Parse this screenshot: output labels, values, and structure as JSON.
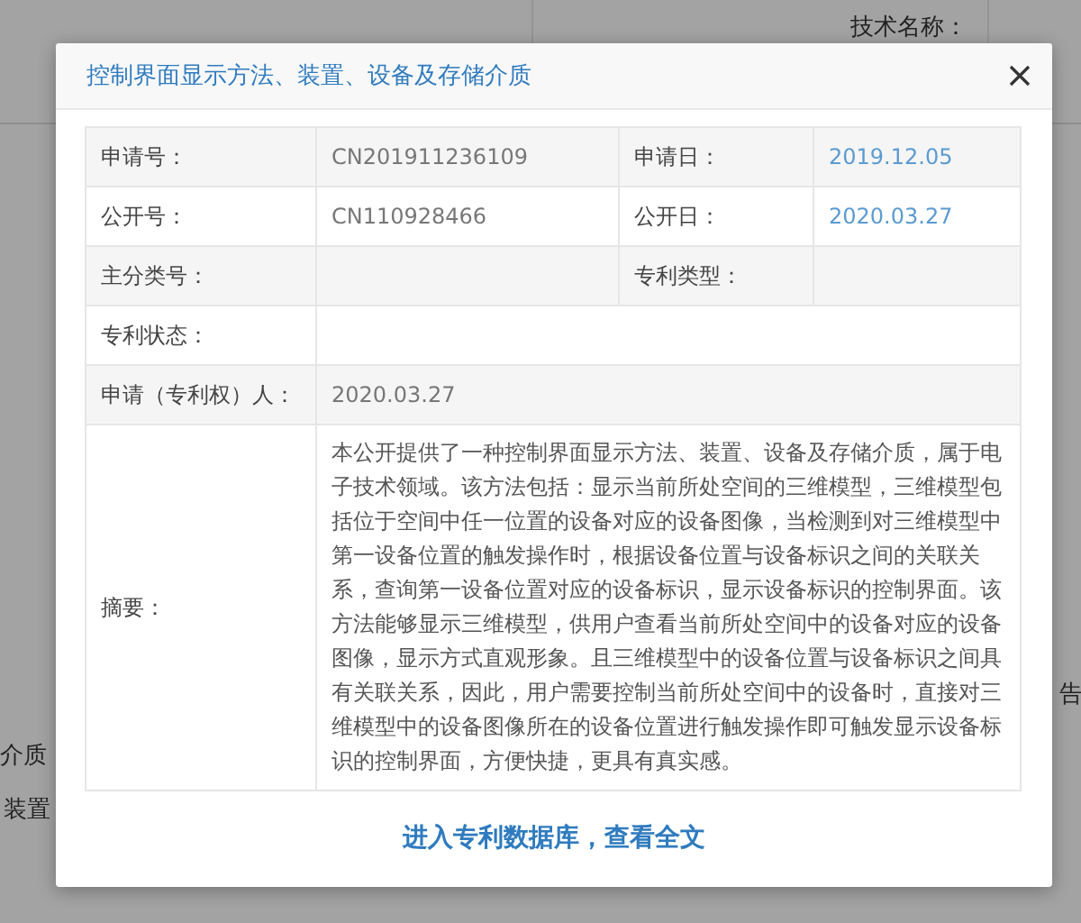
{
  "background": {
    "texts": [
      {
        "kind": "top-right",
        "text": "技术名称："
      },
      {
        "kind": "right",
        "text": "告"
      },
      {
        "kind": "left1",
        "text": "介质"
      },
      {
        "kind": "left2",
        "text": "装置"
      }
    ]
  },
  "dialog": {
    "title": "控制界面显示方法、装置、设备及存储介质",
    "rows": [
      {
        "cells": [
          {
            "kind": "label",
            "text": "申请号："
          },
          {
            "kind": "value",
            "text": "CN201911236109"
          },
          {
            "kind": "label",
            "text": "申请日："
          },
          {
            "kind": "date",
            "text": "2019.12.05"
          }
        ]
      },
      {
        "cells": [
          {
            "kind": "label",
            "text": "公开号："
          },
          {
            "kind": "value",
            "text": "CN110928466"
          },
          {
            "kind": "label",
            "text": "公开日："
          },
          {
            "kind": "date",
            "text": "2020.03.27"
          }
        ]
      },
      {
        "cells": [
          {
            "kind": "label",
            "text": "主分类号："
          },
          {
            "kind": "value"
          },
          {
            "kind": "label",
            "text": "专利类型："
          },
          {
            "kind": "value"
          }
        ]
      },
      {
        "cells": [
          {
            "kind": "label",
            "text": "专利状态："
          },
          {
            "kind": "value",
            "colspan": 3
          }
        ]
      },
      {
        "cells": [
          {
            "kind": "label",
            "text": "申请（专利权）人："
          },
          {
            "kind": "value",
            "colspan": 3,
            "text": "2020.03.27"
          }
        ]
      },
      {
        "cells": [
          {
            "kind": "label",
            "text": "摘要："
          },
          {
            "kind": "value",
            "colspan": 3,
            "text": "本公开提供了一种控制界面显示方法、装置、设备及存储介质，属于电子技术领域。该方法包括：显示当前所处空间的三维模型，三维模型包括位于空间中任一位置的设备对应的设备图像，当检测到对三维模型中第一设备位置的触发操作时，根据设备位置与设备标识之间的关联关系，查询第一设备位置对应的设备标识，显示设备标识的控制界面。该方法能够显示三维模型，供用户查看当前所处空间中的设备对应的设备图像，显示方式直观形象。且三维模型中的设备位置与设备标识之间具有关联关系，因此，用户需要控制当前所处空间中的设备时，直接对三维模型中的设备图像所在的设备位置进行触发操作即可触发显示设备标识的控制界面，方便快捷，更具有真实感。"
          }
        ]
      }
    ],
    "link": "进入专利数据库，查看全文"
  }
}
